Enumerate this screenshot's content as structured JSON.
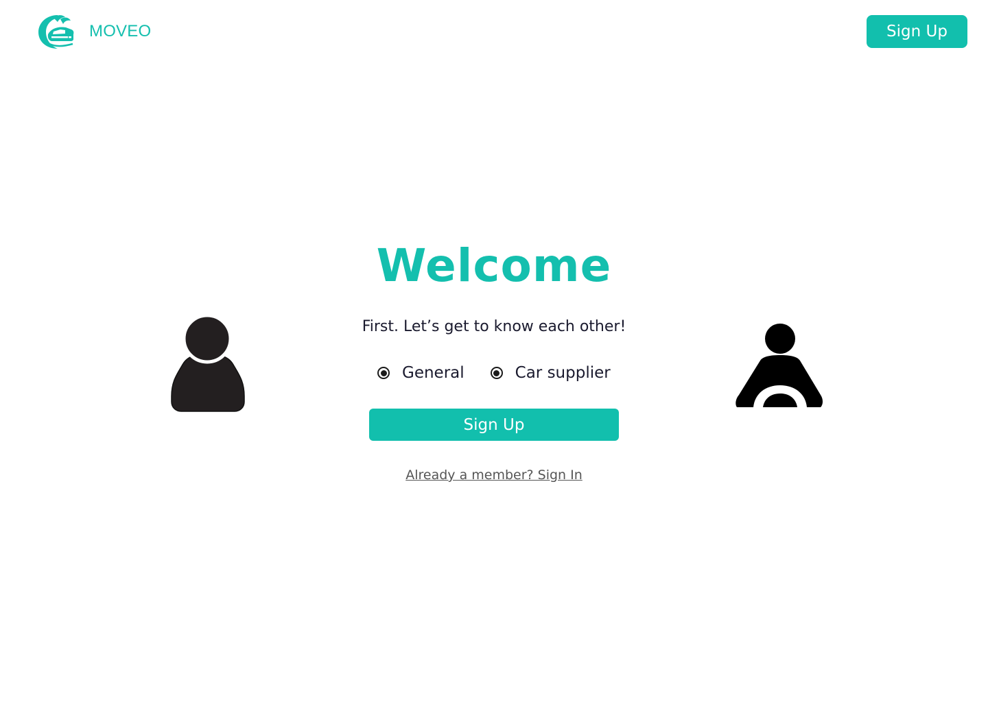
{
  "header": {
    "brand_name": "MOVEO",
    "logo_icon": "car-splash-logo",
    "signup_label": "Sign Up"
  },
  "main": {
    "title": "Welcome",
    "subtitle": "First. Let’s get to know each other!",
    "roles": [
      {
        "label": "General",
        "icon": "person-icon",
        "selected": true
      },
      {
        "label": "Car supplier",
        "icon": "driver-steering-icon",
        "selected": true
      }
    ],
    "signup_label": "Sign Up",
    "signin_link": "Already a member? Sign In"
  },
  "colors": {
    "accent": "#12bfad",
    "text_dark": "#1a1a2e",
    "link_gray": "#555555",
    "icon_dark": "#231f20"
  }
}
